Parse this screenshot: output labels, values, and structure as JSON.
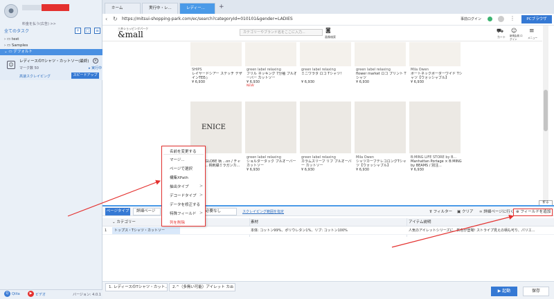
{
  "sidebar": {
    "user_sub": "料金を払う(広告) >>",
    "tasks_title": "全てのタスク",
    "tree": [
      {
        "label": "test"
      },
      {
        "label": "Samples"
      },
      {
        "label": "デフォルト"
      }
    ],
    "task": {
      "title": "レディースのTシャツ・カットソー(最終) ...",
      "meta": "マーク数  50",
      "run": "▸ 実行中",
      "link": "高速スクレイピング",
      "speed_button": "スピードアップ"
    },
    "footer": {
      "q_label": "Qiita",
      "v_label": "ビデオ",
      "version": "バージョン: 4.0.1"
    }
  },
  "browser": {
    "tabs": [
      {
        "label": "ホーム"
      },
      {
        "label": "実行中・レ..."
      },
      {
        "label": "レディー..."
      }
    ],
    "url": "https://mitsui-shopping-park.com/ec/search?categoryId=010101&gender=LADIES",
    "pre_login": "事前ログイン",
    "pc_browser": "PCブラウザ"
  },
  "site": {
    "brand_sub": "三井ショッピングパーク",
    "brand": "&mall",
    "search_placeholder": "カテゴリーやブランド名をここに入力...",
    "camera_label": "画像検索",
    "cart_label": "カート",
    "member_label": "新規会員 ログイン",
    "menu_label": "メニュー"
  },
  "products_row1": [
    {
      "brand": "SHIPS",
      "name": "レイヤードシアー ステッチ デザインTEE◇",
      "price": "¥ 6,930",
      "new": ""
    },
    {
      "brand": "green label relaxing",
      "name": "フリル ネッキング 7分袖 プルオーバー カットソー",
      "price": "¥ 6,930",
      "new": "NEW"
    },
    {
      "brand": "green label relaxing",
      "name": "ミニワラタ ロゴ Tシャツ！",
      "price": "¥ 6,930",
      "new": ""
    },
    {
      "brand": "green label relaxing",
      "name": "flower market ロゴ プリント Tシャツ",
      "price": "¥ 6,930",
      "new": ""
    },
    {
      "brand": "Mila Owen",
      "name": "ボートネックボーダーワイド Tシャツ【ウォッシャブル】",
      "price": "¥ 6,930",
      "new": ""
    }
  ],
  "products_row2": [
    {
      "brand": "...",
      "name": "... ICE / GLOBE 柄 ...on / チャンボ オ ... 柄刺繍ミラガンカ...",
      "price": "¥ 6,930",
      "print": "ENICE"
    },
    {
      "brand": "green label relaxing",
      "name": "ショルダータック プルオーバー カットソー",
      "price": "¥ 6,930",
      "print": ""
    },
    {
      "brand": "green label relaxing",
      "name": "カラムスリーブ リブ プルオーバー カットソー",
      "price": "¥ 6,930",
      "print": ""
    },
    {
      "brand": "Mila Owen",
      "name": "シャツカーブテレコロングTシャツ【ウォッシャブル】",
      "price": "¥ 6,930",
      "print": ""
    },
    {
      "brand": "B:MING LIFE STORE by B...",
      "name": "Manhattan Portage × B:MING by BEAMS / 別注...",
      "price": "¥ 6,930",
      "print": ""
    }
  ],
  "context_menu": [
    {
      "label": "名前を変更する",
      "arrow": ""
    },
    {
      "label": "マージ...",
      "arrow": ""
    },
    {
      "label": "ページで選択",
      "arrow": ""
    },
    {
      "label": "構集XPath",
      "arrow": ""
    },
    {
      "label": "抽出タイプ",
      "arrow": ">"
    },
    {
      "label": "デコードタイプ",
      "arrow": ">"
    },
    {
      "label": "データを修正する",
      "arrow": ""
    },
    {
      "label": "特殊フィールド",
      "arrow": ">"
    },
    {
      "label": "列を削除",
      "arrow": ""
    }
  ],
  "bottom_panel": {
    "page_type": "ページタイプ",
    "detail_page": "詳細ページ",
    "dropdown_needed": "必要なし",
    "scroll_setting": "スクレイピング範囲を指定",
    "filter": "フィルター",
    "clear": "クリア",
    "goto_detail": "詳細ページに行く",
    "add_field": "フィールドを追加",
    "collapse": "折る",
    "columns": [
      "カテゴリー",
      "素材",
      "アイテム説明"
    ],
    "rows": [
      {
        "num": "1",
        "category": "トップス・Tシャツ・カットソー",
        "material": "本体: コットン99%、ポリウレタン1%、リブ: コットン100%",
        "desc": "人気のアイレットシリーズに、新色が登場! ストライプ見えの柄も可り、パリエ..."
      }
    ]
  },
  "bottom_bar": {
    "tabs": [
      {
        "label": "1. レディースのTシャツ・カット..."
      },
      {
        "label": "2.^（多無い可能）アイレット カ..."
      }
    ],
    "run": "起動",
    "save": "保存"
  },
  "colors": {
    "accent": "#3579d4",
    "highlight": "#e4312f"
  }
}
